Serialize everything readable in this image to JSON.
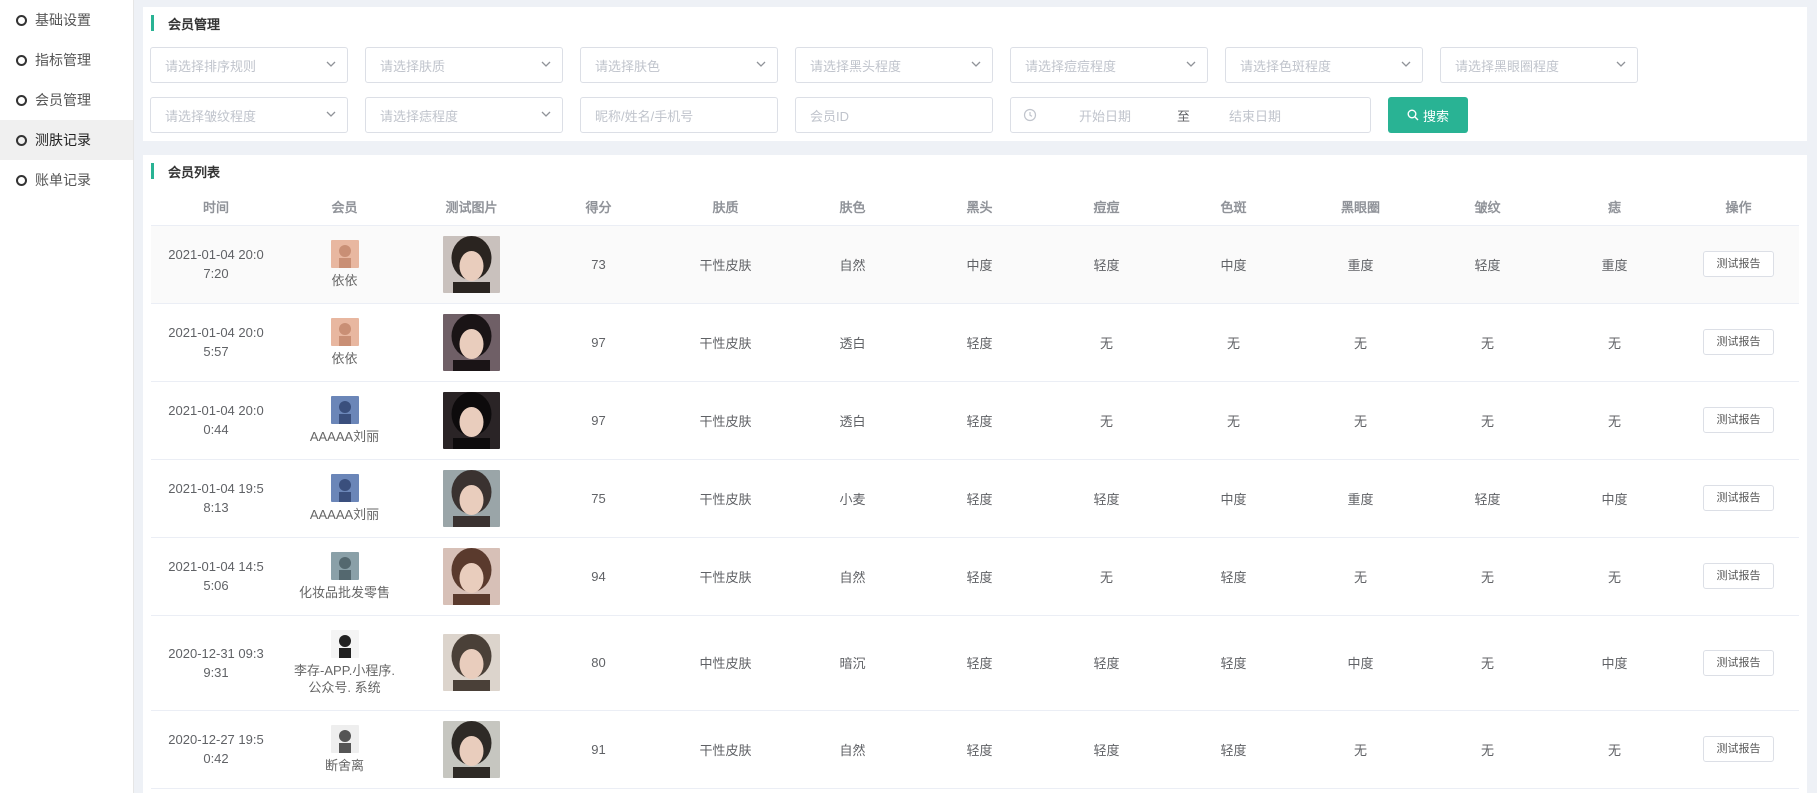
{
  "sidebar": {
    "items": [
      {
        "label": "基础设置"
      },
      {
        "label": "指标管理"
      },
      {
        "label": "会员管理"
      },
      {
        "label": "测肤记录"
      },
      {
        "label": "账单记录"
      }
    ],
    "active_index": 3
  },
  "filter_panel": {
    "title": "会员管理",
    "selects_row1": [
      "请选择排序规则",
      "请选择肤质",
      "请选择肤色",
      "请选择黑头程度",
      "请选择痘痘程度",
      "请选择色斑程度",
      "请选择黑眼圈程度"
    ],
    "selects_row2": [
      "请选择皱纹程度",
      "请选择痣程度"
    ],
    "name_input_placeholder": "昵称/姓名/手机号",
    "id_input_placeholder": "会员ID",
    "date_start": "开始日期",
    "date_sep": "至",
    "date_end": "结束日期",
    "search_label": "搜索"
  },
  "list_panel": {
    "title": "会员列表",
    "columns": [
      "时间",
      "会员",
      "测试图片",
      "得分",
      "肤质",
      "肤色",
      "黑头",
      "痘痘",
      "色斑",
      "黑眼圈",
      "皱纹",
      "痣",
      "操作"
    ],
    "report_label": "测试报告",
    "rows": [
      {
        "time": "2021-01-04 20:07:20",
        "member": "依依",
        "score": "73",
        "skin_type": "干性皮肤",
        "skin_color": "自然",
        "blackhead": "中度",
        "acne": "轻度",
        "spot": "中度",
        "dark_circle": "重度",
        "wrinkle": "轻度",
        "mole": "重度"
      },
      {
        "time": "2021-01-04 20:05:57",
        "member": "依依",
        "score": "97",
        "skin_type": "干性皮肤",
        "skin_color": "透白",
        "blackhead": "轻度",
        "acne": "无",
        "spot": "无",
        "dark_circle": "无",
        "wrinkle": "无",
        "mole": "无"
      },
      {
        "time": "2021-01-04 20:00:44",
        "member": "AAAAA刘丽",
        "score": "97",
        "skin_type": "干性皮肤",
        "skin_color": "透白",
        "blackhead": "轻度",
        "acne": "无",
        "spot": "无",
        "dark_circle": "无",
        "wrinkle": "无",
        "mole": "无"
      },
      {
        "time": "2021-01-04 19:58:13",
        "member": "AAAAA刘丽",
        "score": "75",
        "skin_type": "干性皮肤",
        "skin_color": "小麦",
        "blackhead": "轻度",
        "acne": "轻度",
        "spot": "中度",
        "dark_circle": "重度",
        "wrinkle": "轻度",
        "mole": "中度"
      },
      {
        "time": "2021-01-04 14:55:06",
        "member": "化妆品批发零售",
        "score": "94",
        "skin_type": "干性皮肤",
        "skin_color": "自然",
        "blackhead": "轻度",
        "acne": "无",
        "spot": "轻度",
        "dark_circle": "无",
        "wrinkle": "无",
        "mole": "无"
      },
      {
        "time": "2020-12-31 09:39:31",
        "member": "李存-APP.小程序.公众号. 系统",
        "score": "80",
        "skin_type": "中性皮肤",
        "skin_color": "暗沉",
        "blackhead": "轻度",
        "acne": "轻度",
        "spot": "轻度",
        "dark_circle": "中度",
        "wrinkle": "无",
        "mole": "中度"
      },
      {
        "time": "2020-12-27 19:50:42",
        "member": "断舍离",
        "score": "91",
        "skin_type": "干性皮肤",
        "skin_color": "自然",
        "blackhead": "轻度",
        "acne": "轻度",
        "spot": "轻度",
        "dark_circle": "无",
        "wrinkle": "无",
        "mole": "无"
      }
    ]
  },
  "colors": {
    "accent": "#29b394",
    "border": "#dcdfe6",
    "placeholder": "#c0c4cc"
  }
}
